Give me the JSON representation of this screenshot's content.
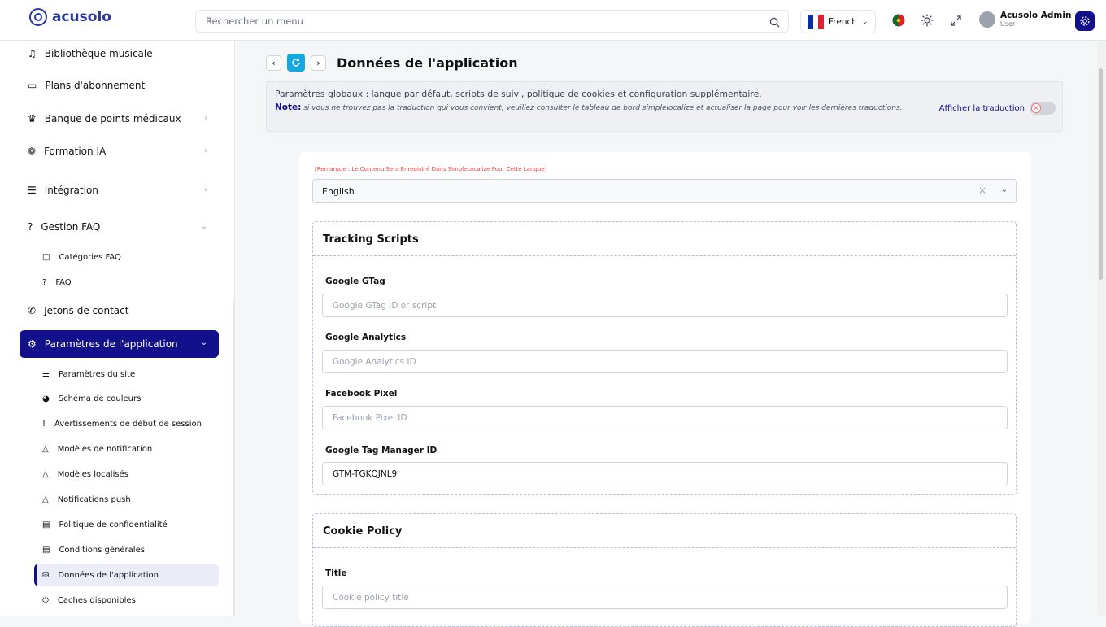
{
  "topbar": {
    "logo_text": "acusolo",
    "search_placeholder": "Rechercher un menu",
    "language": "French",
    "user_name": "Acusolo Admin",
    "user_role": "User"
  },
  "sidebar": {
    "items": [
      {
        "label": "Bibliothèque musicale"
      },
      {
        "label": "Plans d'abonnement"
      },
      {
        "label": "Banque de points médicaux"
      },
      {
        "label": "Formation IA"
      },
      {
        "label": "Intégration"
      },
      {
        "label": "Gestion FAQ"
      },
      {
        "label": "Catégories FAQ"
      },
      {
        "label": "FAQ"
      },
      {
        "label": "Jetons de contact"
      },
      {
        "label": "Paramètres de l'application"
      },
      {
        "label": "Paramètres du site"
      },
      {
        "label": "Schéma de couleurs"
      },
      {
        "label": "Avertissements de début de session"
      },
      {
        "label": "Modèles de notification"
      },
      {
        "label": "Modèles localisés"
      },
      {
        "label": "Notifications push"
      },
      {
        "label": "Politique de confidentialité"
      },
      {
        "label": "Conditions générales"
      },
      {
        "label": "Données de l'application"
      },
      {
        "label": "Caches disponibles"
      }
    ]
  },
  "page": {
    "title": "Données de l'application",
    "notice_line1": "Paramètres globaux : langue par défaut, scripts de suivi, politique de cookies et configuration supplémentaire.",
    "note_label": "Note:",
    "note_text": "si vous ne trouvez pas la traduction qui vous convient, veuillez consulter le tableau de bord simplelocalize et actualiser la page pour voir les dernières traductions.",
    "show_translation": "Afficher la traduction",
    "remark": "[Remarque : Le Contenu Sera Enregistré Dans SimpleLocalize Pour Cette Langue]",
    "language_value": "English"
  },
  "tracking": {
    "heading": "Tracking Scripts",
    "gtag_label": "Google GTag",
    "gtag_placeholder": "Google GTag ID or script",
    "ga_label": "Google Analytics",
    "ga_placeholder": "Google Analytics ID",
    "fb_label": "Facebook Pixel",
    "fb_placeholder": "Facebook Pixel ID",
    "gtm_label": "Google Tag Manager ID",
    "gtm_value": "GTM-TGKQJNL9"
  },
  "cookie": {
    "heading": "Cookie Policy",
    "title_label": "Title",
    "title_placeholder": "Cookie policy title"
  },
  "colors": {
    "primary": "#12108a",
    "accent": "#14a7e0"
  }
}
